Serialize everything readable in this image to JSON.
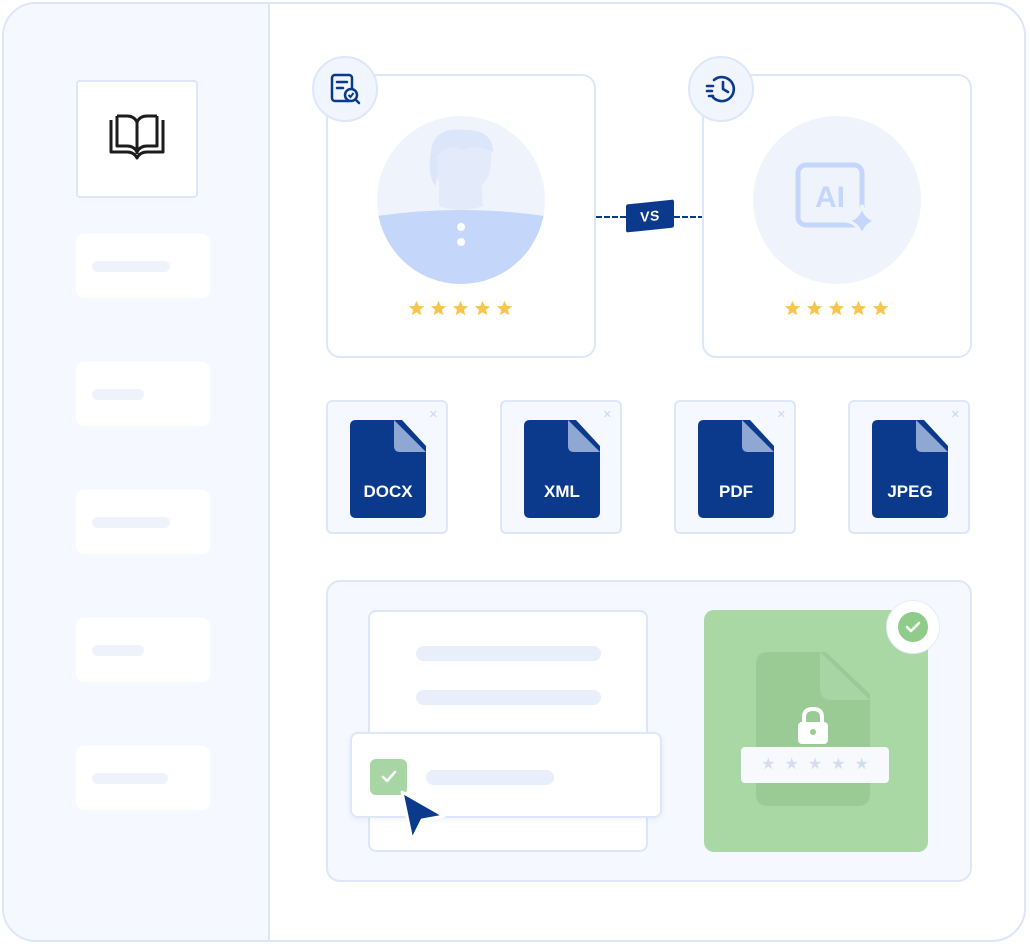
{
  "sidebar": {
    "logo_icon": "open-book-icon",
    "items": [
      {
        "placeholder_width": "medium"
      },
      {
        "placeholder_width": "short"
      },
      {
        "placeholder_width": "medium"
      },
      {
        "placeholder_width": "short"
      },
      {
        "placeholder_width": "short"
      }
    ]
  },
  "comparison": {
    "left": {
      "badge_icon": "document-check-icon",
      "avatar": "human-avatar",
      "rating": 5
    },
    "right": {
      "badge_icon": "history-clock-icon",
      "avatar_text": "AI",
      "rating": 5
    },
    "vs_label": "VS"
  },
  "formats": [
    {
      "label": "DOCX"
    },
    {
      "label": "XML"
    },
    {
      "label": "PDF"
    },
    {
      "label": "JPEG"
    }
  ],
  "secure_panel": {
    "checked": true,
    "lock_icon": "lock-icon",
    "password_mask": "*****"
  },
  "colors": {
    "navy": "#0b3a8c",
    "light_border": "#dde7f9",
    "star": "#f7c547",
    "green": "#aad8a5",
    "avatar_blue": "#c5d6fb"
  }
}
